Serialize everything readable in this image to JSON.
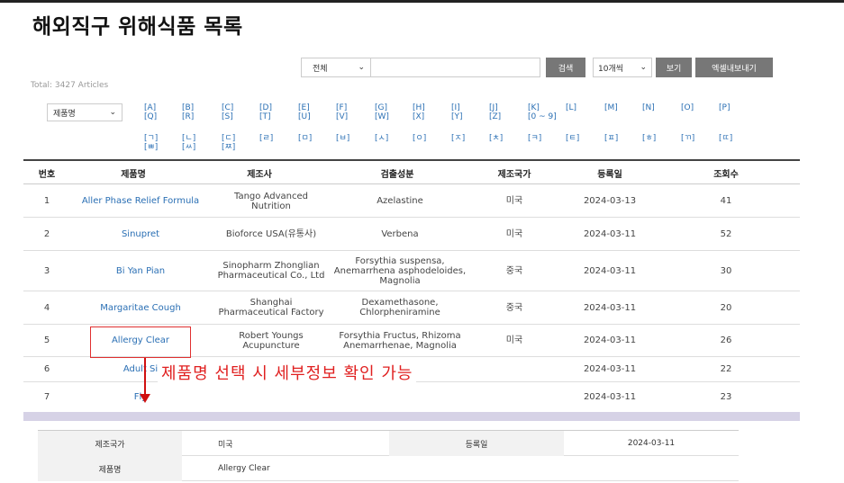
{
  "page_title": "해외직구 위해식품 목록",
  "total_label": "Total: 3427 Articles",
  "search": {
    "field_select": "전체",
    "input_value": "",
    "search_button": "검색",
    "count_select": "10개씩",
    "view_button": "보기",
    "export_button": "엑셀내보내기"
  },
  "category_select": "제품명",
  "alpha_filters": [
    {
      "top": "[A]",
      "bottom": "[Q]"
    },
    {
      "top": "[B]",
      "bottom": "[R]"
    },
    {
      "top": "[C]",
      "bottom": "[S]"
    },
    {
      "top": "[D]",
      "bottom": "[T]"
    },
    {
      "top": "[E]",
      "bottom": "[U]"
    },
    {
      "top": "[F]",
      "bottom": "[V]"
    },
    {
      "top": "[G]",
      "bottom": "[W]"
    },
    {
      "top": "[H]",
      "bottom": "[X]"
    },
    {
      "top": "[I]",
      "bottom": "[Y]"
    },
    {
      "top": "[J]",
      "bottom": "[Z]"
    },
    {
      "top": "[K]",
      "bottom": "[0 ~ 9]"
    },
    {
      "top": "[L]",
      "bottom": ""
    },
    {
      "top": "[M]",
      "bottom": ""
    },
    {
      "top": "[N]",
      "bottom": ""
    },
    {
      "top": "[O]",
      "bottom": ""
    },
    {
      "top": "[P]",
      "bottom": ""
    }
  ],
  "hangul_filters": [
    {
      "top": "[ㄱ]",
      "bottom": "[ㅃ]"
    },
    {
      "top": "[ㄴ]",
      "bottom": "[ㅆ]"
    },
    {
      "top": "[ㄷ]",
      "bottom": "[ㅉ]"
    },
    {
      "top": "[ㄹ]",
      "bottom": ""
    },
    {
      "top": "[ㅁ]",
      "bottom": ""
    },
    {
      "top": "[ㅂ]",
      "bottom": ""
    },
    {
      "top": "[ㅅ]",
      "bottom": ""
    },
    {
      "top": "[ㅇ]",
      "bottom": ""
    },
    {
      "top": "[ㅈ]",
      "bottom": ""
    },
    {
      "top": "[ㅊ]",
      "bottom": ""
    },
    {
      "top": "[ㅋ]",
      "bottom": ""
    },
    {
      "top": "[ㅌ]",
      "bottom": ""
    },
    {
      "top": "[ㅍ]",
      "bottom": ""
    },
    {
      "top": "[ㅎ]",
      "bottom": ""
    },
    {
      "top": "[ㄲ]",
      "bottom": ""
    },
    {
      "top": "[ㄸ]",
      "bottom": ""
    }
  ],
  "table": {
    "headers": [
      "번호",
      "제품명",
      "제조사",
      "검출성분",
      "제조국가",
      "등록일",
      "조회수"
    ],
    "rows": [
      {
        "no": "1",
        "product": "Aller Phase Relief Formula",
        "maker": "Tango Advanced Nutrition",
        "ingredient": "Azelastine",
        "country": "미국",
        "date": "2024-03-13",
        "views": "41"
      },
      {
        "no": "2",
        "product": "Sinupret",
        "maker": "Bioforce USA(유통사)",
        "ingredient": "Verbena",
        "country": "미국",
        "date": "2024-03-11",
        "views": "52"
      },
      {
        "no": "3",
        "product": "Bi Yan Pian",
        "maker": "Sinopharm Zhonglian Pharmaceutical Co., Ltd",
        "ingredient": "Forsythia suspensa, Anemarrhena asphodeloides, Magnolia",
        "country": "중국",
        "date": "2024-03-11",
        "views": "30"
      },
      {
        "no": "4",
        "product": "Margaritae Cough",
        "maker": "Shanghai Pharmaceutical Factory",
        "ingredient": "Dexamethasone, Chlorpheniramine",
        "country": "중국",
        "date": "2024-03-11",
        "views": "20"
      },
      {
        "no": "5",
        "product": "Allergy Clear",
        "maker": "Robert Youngs Acupuncture",
        "ingredient": "Forsythia Fructus, Rhizoma Anemarrhenae, Magnolia",
        "country": "미국",
        "date": "2024-03-11",
        "views": "26"
      },
      {
        "no": "6",
        "product": "Adult Si",
        "maker": "",
        "ingredient": "",
        "country": "",
        "date": "2024-03-11",
        "views": "22"
      },
      {
        "no": "7",
        "product": "Fly",
        "maker": "",
        "ingredient": "",
        "country": "",
        "date": "2024-03-11",
        "views": "23"
      }
    ]
  },
  "annotation": "제품명 선택 시 세부정보 확인 가능",
  "detail": {
    "country_label": "제조국가",
    "country_value": "미국",
    "date_label": "등록일",
    "date_value": "2024-03-11",
    "product_label": "제품명",
    "product_value": "Allergy Clear"
  },
  "colors": {
    "link": "#2a6fb4",
    "annotation": "#e02020",
    "button": "#777777",
    "divider_bar": "#d6d2e6"
  },
  "icons": {
    "select_arrow": "chevron-down-icon",
    "annotation_arrow": "arrow-down-icon"
  }
}
